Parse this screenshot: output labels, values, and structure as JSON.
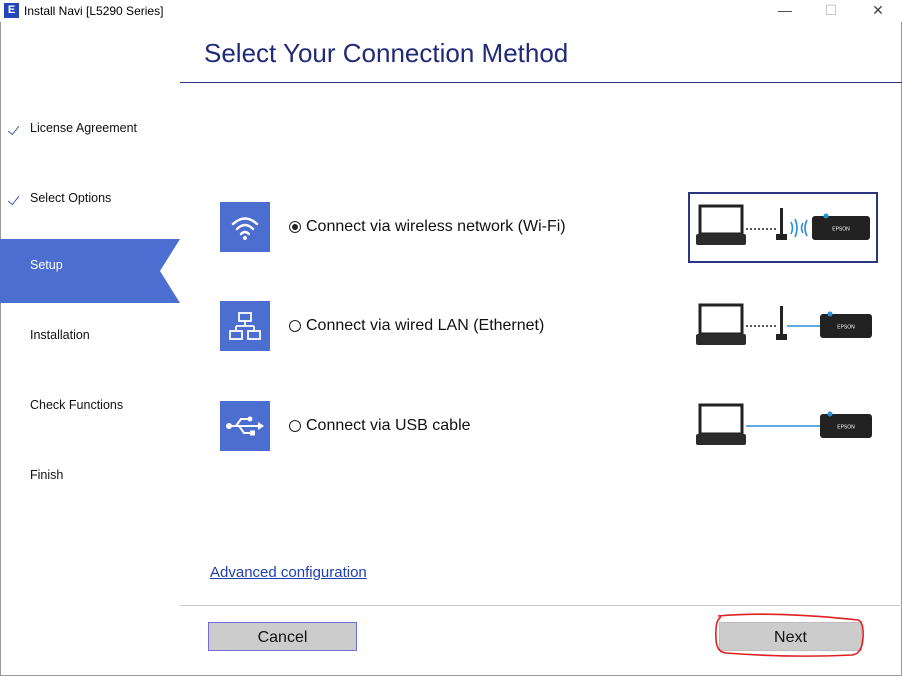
{
  "window": {
    "icon_letter": "E",
    "title": "Install Navi [L5290 Series]",
    "minimize": "—",
    "maximize": "☐",
    "close": "✕"
  },
  "page": {
    "title": "Select Your Connection Method"
  },
  "sidebar": {
    "items": [
      {
        "label": "License Agreement",
        "state": "done"
      },
      {
        "label": "Select Options",
        "state": "done"
      },
      {
        "label": "Setup",
        "state": "active"
      },
      {
        "label": "Installation",
        "state": "pending"
      },
      {
        "label": "Check Functions",
        "state": "pending"
      },
      {
        "label": "Finish",
        "state": "pending"
      }
    ]
  },
  "options": [
    {
      "label": "Connect via wireless network (Wi-Fi)",
      "icon": "wifi-icon",
      "selected": true
    },
    {
      "label": "Connect via wired LAN (Ethernet)",
      "icon": "network-icon",
      "selected": false
    },
    {
      "label": "Connect via USB cable",
      "icon": "usb-icon",
      "selected": false
    }
  ],
  "printer_brand": "EPSON",
  "advanced_link": "Advanced configuration",
  "buttons": {
    "cancel": "Cancel",
    "next": "Next"
  },
  "colors": {
    "accent": "#4b6ed0",
    "title": "#1f2a78",
    "annotation": "#e02020",
    "cable": "#2a8fd6"
  }
}
